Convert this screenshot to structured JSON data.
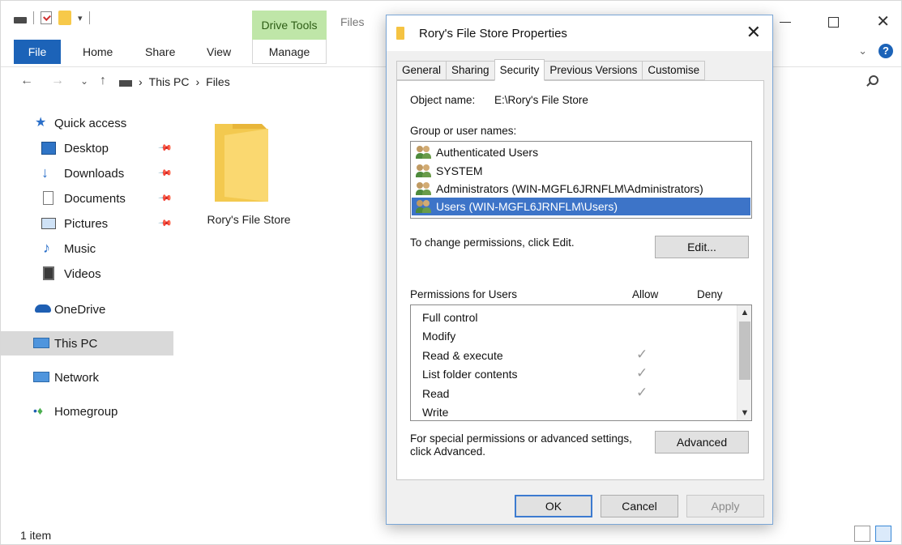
{
  "explorer": {
    "contextual_tab": "Drive Tools",
    "title": "Files",
    "ribbon_tabs": {
      "file": "File",
      "home": "Home",
      "share": "Share",
      "view": "View",
      "manage": "Manage"
    },
    "address": {
      "segment1": "This PC",
      "separator": "›",
      "segment2": "Files"
    },
    "nav": {
      "quick_access": "Quick access",
      "desktop": "Desktop",
      "downloads": "Downloads",
      "documents": "Documents",
      "pictures": "Pictures",
      "music": "Music",
      "videos": "Videos",
      "onedrive": "OneDrive",
      "this_pc": "This PC",
      "network": "Network",
      "homegroup": "Homegroup"
    },
    "folder_name": "Rory's File Store",
    "status": "1 item"
  },
  "dialog": {
    "title": "Rory's File Store Properties",
    "tabs": [
      "General",
      "Sharing",
      "Security",
      "Previous Versions",
      "Customise"
    ],
    "active_tab": "Security",
    "object_name_label": "Object name:",
    "object_name_value": "E:\\Rory's File Store",
    "group_label": "Group or user names:",
    "users": [
      "Authenticated Users",
      "SYSTEM",
      "Administrators (WIN-MGFL6JRNFLM\\Administrators)",
      "Users (WIN-MGFL6JRNFLM\\Users)"
    ],
    "change_text": "To change permissions, click Edit.",
    "edit_button": "Edit...",
    "permissions_label": "Permissions for Users",
    "allow_header": "Allow",
    "deny_header": "Deny",
    "permissions": [
      {
        "name": "Full control",
        "allow": "",
        "deny": ""
      },
      {
        "name": "Modify",
        "allow": "",
        "deny": ""
      },
      {
        "name": "Read & execute",
        "allow": "✓",
        "deny": ""
      },
      {
        "name": "List folder contents",
        "allow": "✓",
        "deny": ""
      },
      {
        "name": "Read",
        "allow": "✓",
        "deny": ""
      },
      {
        "name": "Write",
        "allow": "",
        "deny": ""
      }
    ],
    "special_text_1": "For special permissions or advanced settings,",
    "special_text_2": "click Advanced.",
    "advanced_button": "Advanced",
    "ok_button": "OK",
    "cancel_button": "Cancel",
    "apply_button": "Apply"
  },
  "colors": {
    "accent": "#1c63b8",
    "contextual_tab_bg": "#bfe6a8",
    "selection": "#3d74c8",
    "folder": "#f7c94a"
  }
}
